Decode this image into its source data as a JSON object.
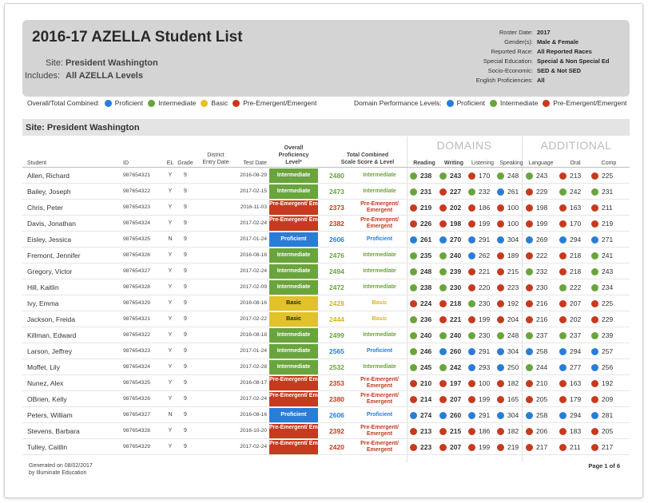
{
  "report": {
    "title": "2016-17 AZELLA Student List",
    "site_label": "Site:",
    "site_value": "President Washington",
    "includes_label": "Includes:",
    "includes_value": "All AZELLA Levels",
    "meta": [
      {
        "label": "Roster Date:",
        "value": "2017"
      },
      {
        "label": "Gender(s):",
        "value": "Male & Female"
      },
      {
        "label": "Reported Race:",
        "value": "All Reported Races"
      },
      {
        "label": "Special Education:",
        "value": "Special & Non Special Ed"
      },
      {
        "label": "Socio-Economic:",
        "value": "SED & Not SED"
      },
      {
        "label": "English Proficiencies:",
        "value": "All"
      }
    ]
  },
  "legend": {
    "overall_title": "Overall/Total Combined:",
    "overall_items": [
      {
        "label": "Proficient",
        "color": "#2a7dd6"
      },
      {
        "label": "Intermediate",
        "color": "#6aa43d"
      },
      {
        "label": "Basic",
        "color": "#e2c22a"
      },
      {
        "label": "Pre-Emergent/Emergent",
        "color": "#c63a1f"
      }
    ],
    "domain_title": "Domain Performance Levels:",
    "domain_items": [
      {
        "label": "Proficient",
        "color": "#2a7dd6"
      },
      {
        "label": "Intermediate",
        "color": "#6aa43d"
      },
      {
        "label": "Pre-Emergent/Emergent",
        "color": "#c63a1f"
      }
    ]
  },
  "site_bar": "Site: President Washington",
  "groups": {
    "domains": "DOMAINS",
    "additional": "ADDITIONAL"
  },
  "columns": {
    "student": "Student",
    "id": "ID",
    "el": "EL",
    "grade": "Grade",
    "district_entry_1": "District",
    "district_entry_2": "Entry Date",
    "test_date": "Test Date",
    "overall_1": "Overall",
    "overall_2": "Proficiency",
    "overall_3": "Level*",
    "total_1": "Total Combined",
    "total_2": "Scale Score & Level",
    "reading": "Reading",
    "writing": "Writing",
    "listening": "Listening",
    "speaking": "Speaking",
    "language": "Language",
    "oral": "Oral",
    "comp": "Comp"
  },
  "level_colors": {
    "Proficient": "#2a7dd6",
    "Intermediate": "#6aa43d",
    "Basic": "#e2c22a",
    "Pre-Emergent/ Emergent": "#c63a1f"
  },
  "domain_colors": {
    "P": "#2a7dd6",
    "I": "#6aa43d",
    "E": "#c63a1f"
  },
  "students": [
    {
      "name": "Allen, Richard",
      "id": "987654321",
      "el": "Y",
      "grade": "9",
      "test_date": "2016-08-29",
      "level": "Intermediate",
      "score": "2480",
      "score_level": "Intermediate",
      "domains": [
        [
          "238",
          "I"
        ],
        [
          "243",
          "I"
        ],
        [
          "170",
          "E"
        ],
        [
          "248",
          "I"
        ]
      ],
      "additional": [
        [
          "243",
          "I"
        ],
        [
          "213",
          "E"
        ],
        [
          "225",
          "E"
        ]
      ]
    },
    {
      "name": "Bailey, Joseph",
      "id": "987654322",
      "el": "Y",
      "grade": "9",
      "test_date": "2017-02-15",
      "level": "Intermediate",
      "score": "2473",
      "score_level": "Intermediate",
      "domains": [
        [
          "231",
          "I"
        ],
        [
          "227",
          "E"
        ],
        [
          "232",
          "I"
        ],
        [
          "261",
          "P"
        ]
      ],
      "additional": [
        [
          "229",
          "E"
        ],
        [
          "242",
          "I"
        ],
        [
          "231",
          "I"
        ]
      ]
    },
    {
      "name": "Chris, Peter",
      "id": "987654323",
      "el": "Y",
      "grade": "9",
      "test_date": "2016-11-03",
      "level": "Pre-Emergent/ Emergent",
      "score": "2373",
      "score_level": "Pre-Emergent/ Emergent",
      "domains": [
        [
          "219",
          "E"
        ],
        [
          "202",
          "E"
        ],
        [
          "186",
          "E"
        ],
        [
          "100",
          "E"
        ]
      ],
      "additional": [
        [
          "198",
          "E"
        ],
        [
          "163",
          "E"
        ],
        [
          "211",
          "E"
        ]
      ]
    },
    {
      "name": "Davis, Jonathan",
      "id": "987654324",
      "el": "Y",
      "grade": "9",
      "test_date": "2017-02-24",
      "level": "Pre-Emergent/ Emergent",
      "score": "2382",
      "score_level": "Pre-Emergent/ Emergent",
      "domains": [
        [
          "226",
          "E"
        ],
        [
          "198",
          "E"
        ],
        [
          "199",
          "E"
        ],
        [
          "100",
          "E"
        ]
      ],
      "additional": [
        [
          "199",
          "E"
        ],
        [
          "170",
          "E"
        ],
        [
          "219",
          "E"
        ]
      ]
    },
    {
      "name": "Eisley, Jessica",
      "id": "987654325",
      "el": "N",
      "grade": "9",
      "test_date": "2017-01-24",
      "level": "Proficient",
      "score": "2606",
      "score_level": "Proficient",
      "domains": [
        [
          "261",
          "P"
        ],
        [
          "270",
          "P"
        ],
        [
          "291",
          "P"
        ],
        [
          "304",
          "P"
        ]
      ],
      "additional": [
        [
          "269",
          "P"
        ],
        [
          "294",
          "P"
        ],
        [
          "271",
          "P"
        ]
      ]
    },
    {
      "name": "Fremont, Jennifer",
      "id": "987654326",
      "el": "Y",
      "grade": "9",
      "test_date": "2016-08-18",
      "level": "Intermediate",
      "score": "2476",
      "score_level": "Intermediate",
      "domains": [
        [
          "235",
          "I"
        ],
        [
          "240",
          "I"
        ],
        [
          "262",
          "P"
        ],
        [
          "189",
          "E"
        ]
      ],
      "additional": [
        [
          "222",
          "E"
        ],
        [
          "218",
          "E"
        ],
        [
          "241",
          "I"
        ]
      ]
    },
    {
      "name": "Gregory, Victor",
      "id": "987654327",
      "el": "Y",
      "grade": "9",
      "test_date": "2017-02-24",
      "level": "Intermediate",
      "score": "2494",
      "score_level": "Intermediate",
      "domains": [
        [
          "248",
          "I"
        ],
        [
          "239",
          "I"
        ],
        [
          "221",
          "E"
        ],
        [
          "215",
          "E"
        ]
      ],
      "additional": [
        [
          "232",
          "I"
        ],
        [
          "218",
          "E"
        ],
        [
          "243",
          "I"
        ]
      ]
    },
    {
      "name": "Hill, Kaitlin",
      "id": "987654328",
      "el": "Y",
      "grade": "9",
      "test_date": "2017-02-09",
      "level": "Intermediate",
      "score": "2472",
      "score_level": "Intermediate",
      "domains": [
        [
          "238",
          "I"
        ],
        [
          "230",
          "I"
        ],
        [
          "220",
          "E"
        ],
        [
          "223",
          "E"
        ]
      ],
      "additional": [
        [
          "230",
          "E"
        ],
        [
          "222",
          "I"
        ],
        [
          "234",
          "I"
        ]
      ]
    },
    {
      "name": "Ivy, Emma",
      "id": "987654329",
      "el": "Y",
      "grade": "9",
      "test_date": "2016-08-16",
      "level": "Basic",
      "score": "2428",
      "score_level": "Basic",
      "domains": [
        [
          "224",
          "E"
        ],
        [
          "218",
          "E"
        ],
        [
          "230",
          "I"
        ],
        [
          "192",
          "E"
        ]
      ],
      "additional": [
        [
          "216",
          "E"
        ],
        [
          "207",
          "E"
        ],
        [
          "225",
          "E"
        ]
      ]
    },
    {
      "name": "Jackson, Freida",
      "id": "987654321",
      "el": "Y",
      "grade": "9",
      "test_date": "2017-02-22",
      "level": "Basic",
      "score": "2444",
      "score_level": "Basic",
      "domains": [
        [
          "236",
          "I"
        ],
        [
          "221",
          "E"
        ],
        [
          "199",
          "E"
        ],
        [
          "204",
          "E"
        ]
      ],
      "additional": [
        [
          "216",
          "E"
        ],
        [
          "202",
          "E"
        ],
        [
          "229",
          "E"
        ]
      ]
    },
    {
      "name": "Killman, Edward",
      "id": "987654322",
      "el": "Y",
      "grade": "9",
      "test_date": "2016-08-18",
      "level": "Intermediate",
      "score": "2499",
      "score_level": "Intermediate",
      "domains": [
        [
          "240",
          "I"
        ],
        [
          "240",
          "I"
        ],
        [
          "230",
          "I"
        ],
        [
          "248",
          "I"
        ]
      ],
      "additional": [
        [
          "237",
          "I"
        ],
        [
          "237",
          "I"
        ],
        [
          "239",
          "I"
        ]
      ]
    },
    {
      "name": "Larson, Jeffrey",
      "id": "987654323",
      "el": "Y",
      "grade": "9",
      "test_date": "2017-01-24",
      "level": "Intermediate",
      "score": "2565",
      "score_level": "Proficient",
      "domains": [
        [
          "246",
          "I"
        ],
        [
          "260",
          "P"
        ],
        [
          "291",
          "P"
        ],
        [
          "304",
          "P"
        ]
      ],
      "additional": [
        [
          "258",
          "P"
        ],
        [
          "294",
          "P"
        ],
        [
          "257",
          "P"
        ]
      ]
    },
    {
      "name": "Moffet, Lily",
      "id": "987654324",
      "el": "Y",
      "grade": "9",
      "test_date": "2017-02-28",
      "level": "Intermediate",
      "score": "2532",
      "score_level": "Intermediate",
      "domains": [
        [
          "245",
          "I"
        ],
        [
          "242",
          "I"
        ],
        [
          "293",
          "P"
        ],
        [
          "250",
          "P"
        ]
      ],
      "additional": [
        [
          "244",
          "I"
        ],
        [
          "277",
          "P"
        ],
        [
          "256",
          "P"
        ]
      ]
    },
    {
      "name": "Nunez, Alex",
      "id": "987654325",
      "el": "Y",
      "grade": "9",
      "test_date": "2016-08-17",
      "level": "Pre-Emergent/ Emergent",
      "score": "2353",
      "score_level": "Pre-Emergent/ Emergent",
      "domains": [
        [
          "210",
          "E"
        ],
        [
          "197",
          "E"
        ],
        [
          "100",
          "E"
        ],
        [
          "182",
          "E"
        ]
      ],
      "additional": [
        [
          "210",
          "E"
        ],
        [
          "163",
          "E"
        ],
        [
          "192",
          "E"
        ]
      ]
    },
    {
      "name": "OBrien, Kelly",
      "id": "987654326",
      "el": "Y",
      "grade": "9",
      "test_date": "2017-02-24",
      "level": "Pre-Emergent/ Emergent",
      "score": "2380",
      "score_level": "Pre-Emergent/ Emergent",
      "domains": [
        [
          "214",
          "E"
        ],
        [
          "207",
          "E"
        ],
        [
          "199",
          "E"
        ],
        [
          "165",
          "E"
        ]
      ],
      "additional": [
        [
          "205",
          "E"
        ],
        [
          "179",
          "E"
        ],
        [
          "209",
          "E"
        ]
      ]
    },
    {
      "name": "Peters, William",
      "id": "987654327",
      "el": "N",
      "grade": "9",
      "test_date": "2016-08-16",
      "level": "Proficient",
      "score": "2606",
      "score_level": "Proficient",
      "domains": [
        [
          "274",
          "P"
        ],
        [
          "260",
          "P"
        ],
        [
          "291",
          "P"
        ],
        [
          "304",
          "P"
        ]
      ],
      "additional": [
        [
          "258",
          "P"
        ],
        [
          "294",
          "P"
        ],
        [
          "281",
          "P"
        ]
      ]
    },
    {
      "name": "Stevens, Barbara",
      "id": "987654328",
      "el": "Y",
      "grade": "9",
      "test_date": "2016-10-20",
      "level": "Pre-Emergent/ Emergent",
      "score": "2392",
      "score_level": "Pre-Emergent/ Emergent",
      "domains": [
        [
          "213",
          "E"
        ],
        [
          "215",
          "E"
        ],
        [
          "186",
          "E"
        ],
        [
          "182",
          "E"
        ]
      ],
      "additional": [
        [
          "206",
          "E"
        ],
        [
          "183",
          "E"
        ],
        [
          "205",
          "E"
        ]
      ]
    },
    {
      "name": "Tulley, Caitlin",
      "id": "987654329",
      "el": "Y",
      "grade": "9",
      "test_date": "2017-02-24",
      "level": "Pre-Emergent/ Emergent",
      "score": "2420",
      "score_level": "Pre-Emergent/ Emergent",
      "domains": [
        [
          "223",
          "E"
        ],
        [
          "207",
          "E"
        ],
        [
          "199",
          "E"
        ],
        [
          "219",
          "E"
        ]
      ],
      "additional": [
        [
          "217",
          "E"
        ],
        [
          "211",
          "E"
        ],
        [
          "217",
          "E"
        ]
      ]
    }
  ],
  "footer": {
    "generated_1": "Generated on 08/02/2017",
    "generated_2": "by Illuminate Education",
    "page": "Page 1 of 6"
  }
}
